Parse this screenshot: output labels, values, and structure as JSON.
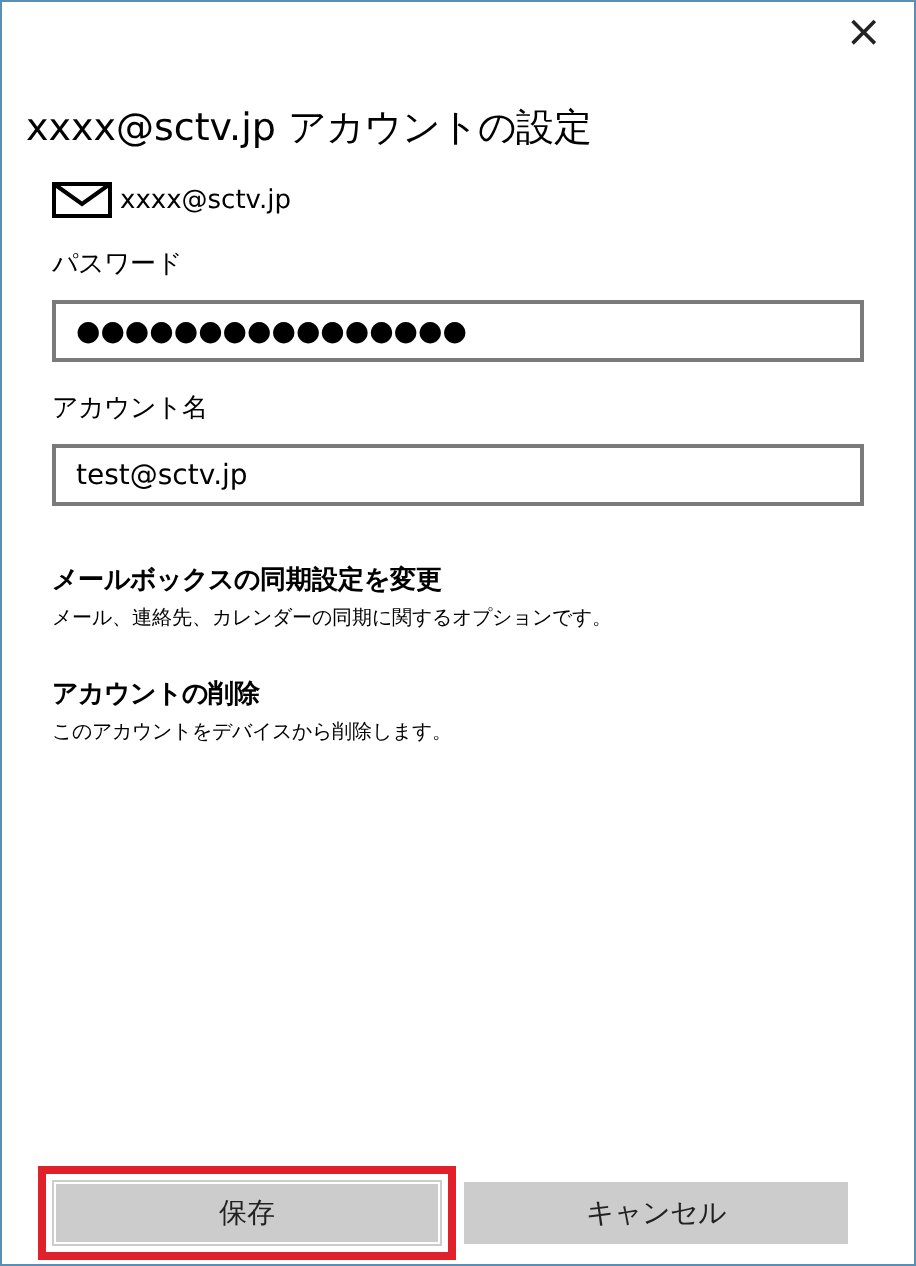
{
  "window": {
    "close": "×"
  },
  "title": "xxxx@sctv.jp アカウントの設定",
  "account": {
    "email": "xxxx@sctv.jp"
  },
  "fields": [
    {
      "label": "パスワード",
      "value": "●●●●●●●●●●●●●●●●"
    },
    {
      "label": "アカウント名",
      "value": "test@sctv.jp"
    }
  ],
  "links": [
    {
      "title": "メールボックスの同期設定を変更",
      "description": "メール、連絡先、カレンダーの同期に関するオプションです。"
    },
    {
      "title": "アカウントの削除",
      "description": "このアカウントをデバイスから削除します。"
    }
  ],
  "buttons": [
    {
      "label": "保存",
      "highlighted": true
    },
    {
      "label": "キャンセル",
      "highlighted": false
    }
  ]
}
